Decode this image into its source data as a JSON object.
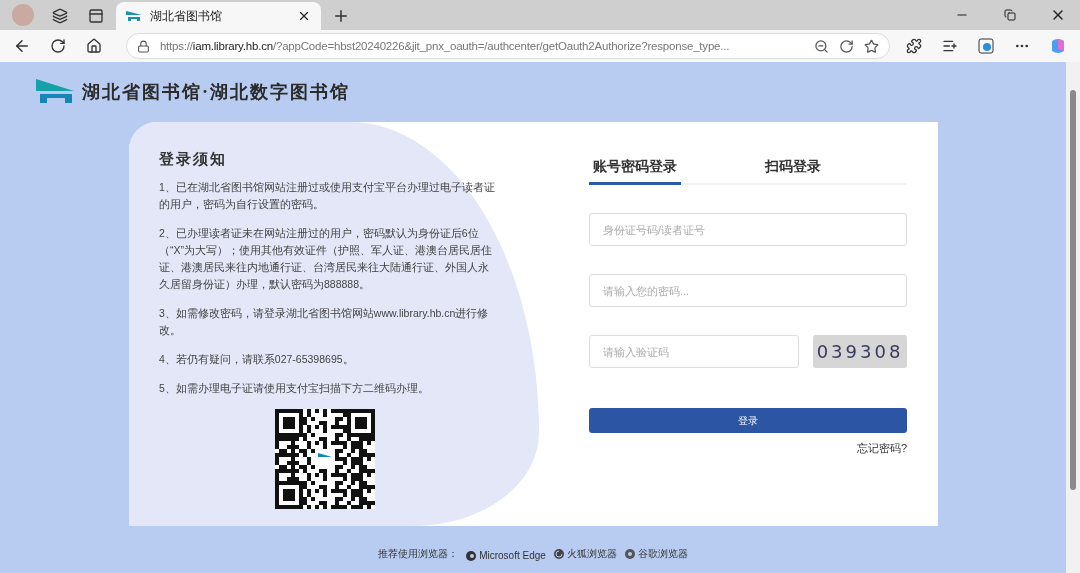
{
  "browser": {
    "tabs": [
      {
        "title": "湖北省图书馆",
        "selected": true
      }
    ],
    "address": {
      "scheme": "https://",
      "host": "iam.library.hb.cn",
      "path": "/?appCode=hbst20240226&jit_pnx_oauth=/authcenter/getOauth2Authorize?response_type..."
    }
  },
  "header": {
    "logo_text": "湖北省图书馆·湖北数字图书馆"
  },
  "notice": {
    "title": "登录须知",
    "items": [
      "1、已在湖北省图书馆网站注册过或使用支付宝平台办理过电子读者证的用户，密码为自行设置的密码。",
      "2、已办理读者证未在网站注册过的用户，密码默认为身份证后6位（“X”为大写）；使用其他有效证件（护照、军人证、港澳台居民居住证、港澳居民来往内地通行证、台湾居民来往大陆通行证、外国人永久居留身份证）办理，默认密码为888888。",
      "3、如需修改密码，请登录湖北省图书馆网站www.library.hb.cn进行修改。",
      "4、若仍有疑问，请联系027-65398695。",
      "5、如需办理电子证请使用支付宝扫描下方二维码办理。"
    ]
  },
  "login": {
    "tabs": [
      {
        "label": "账号密码登录",
        "selected": true
      },
      {
        "label": "扫码登录",
        "selected": false
      }
    ],
    "fields": [
      {
        "kind": "text",
        "placeholder": "身份证号码/读者证号"
      },
      {
        "kind": "password",
        "placeholder": "请输入您的密码..."
      },
      {
        "kind": "captcha",
        "placeholder": "请输入验证码",
        "captcha": "039308"
      }
    ],
    "submit": "登录",
    "forgot": "忘记密码?"
  },
  "footer": {
    "label": "推荐使用浏览器：",
    "browsers": [
      {
        "kind": "edge",
        "name": "Microsoft Edge"
      },
      {
        "kind": "firefox",
        "name": "火狐浏览器"
      },
      {
        "kind": "chrome",
        "name": "谷歌浏览器"
      }
    ]
  }
}
